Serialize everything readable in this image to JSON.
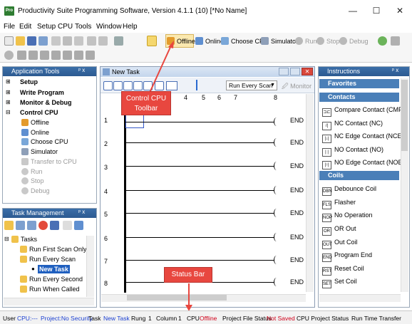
{
  "window": {
    "icon_label": "Pro",
    "title": "Productivity Suite Programming Software, Version 4.1.1 (10)  [*No Name]",
    "minimize": "—",
    "maximize": "☐",
    "close": "✕"
  },
  "menu": [
    "File",
    "Edit",
    "Setup",
    "CPU",
    "Tools",
    "Window",
    "Help"
  ],
  "toolbar": {
    "offline": "Offline",
    "online": "Online",
    "choose_cpu": "Choose CPU",
    "simulator": "Simulator",
    "run": "Run",
    "stop": "Stop",
    "debug": "Debug"
  },
  "app_tools": {
    "title": "Application Tools",
    "pin": "ᵖ x",
    "items": [
      {
        "label": "Setup",
        "style": "bold"
      },
      {
        "label": "Write Program",
        "style": "bold"
      },
      {
        "label": "Monitor & Debug",
        "style": "bold"
      },
      {
        "label": "Control CPU",
        "style": "bold"
      },
      {
        "label": "Offline",
        "style": "normal"
      },
      {
        "label": "Online",
        "style": "normal"
      },
      {
        "label": "Choose CPU",
        "style": "normal"
      },
      {
        "label": "Simulator",
        "style": "normal"
      },
      {
        "label": "Transfer to CPU",
        "style": "grey"
      },
      {
        "label": "Run",
        "style": "grey"
      },
      {
        "label": "Stop",
        "style": "grey"
      },
      {
        "label": "Debug",
        "style": "grey"
      }
    ]
  },
  "task_mgmt": {
    "title": "Task Management",
    "pin": "ᵖ x",
    "items": [
      {
        "label": "Tasks"
      },
      {
        "label": "Run First Scan Only"
      },
      {
        "label": "Run Every Scan"
      },
      {
        "label": "New Task"
      },
      {
        "label": "Run Every Second"
      },
      {
        "label": "Run When Called"
      }
    ]
  },
  "editor": {
    "title": "New Task",
    "scan_mode": "Run Every Scan",
    "monitor": "Monitor",
    "columns": [
      "4",
      "5",
      "6",
      "7",
      "8"
    ],
    "rungs": [
      "1",
      "2",
      "3",
      "4",
      "5",
      "6",
      "7",
      "8"
    ],
    "end_label": "END"
  },
  "instructions": {
    "title": "Instructions",
    "pin": "ᵖ x",
    "favorites": "Favorites",
    "contacts": "Contacts",
    "coils": "Coils",
    "contact_items": [
      {
        "glyph": "⊐⊏",
        "label": "Compare Contact (CMP)"
      },
      {
        "glyph": "/|",
        "label": "NC Contact (NC)"
      },
      {
        "glyph": "|↓|",
        "label": "NC Edge Contact (NCE)"
      },
      {
        "glyph": "| |",
        "label": "NO Contact (NO)"
      },
      {
        "glyph": "|↑|",
        "label": "NO Edge Contact (NOE)"
      }
    ],
    "coil_items": [
      {
        "glyph": "DBN",
        "label": "Debounce Coil"
      },
      {
        "glyph": "FLS",
        "label": "Flasher"
      },
      {
        "glyph": "NOP",
        "label": "No Operation"
      },
      {
        "glyph": "OR",
        "label": "OR Out"
      },
      {
        "glyph": "OUT",
        "label": "Out Coil"
      },
      {
        "glyph": "END",
        "label": "Program End"
      },
      {
        "glyph": "RST",
        "label": "Reset Coil"
      },
      {
        "glyph": "SET",
        "label": "Set Coil"
      }
    ]
  },
  "callouts": {
    "control_cpu": "Control CPU\nToolbar",
    "status_bar": "Status Bar"
  },
  "status": {
    "user": "User",
    "cpu_label": "CPU:---",
    "project": "Project:No Security",
    "task_label": "Task",
    "task_value": "New Task",
    "rung_label": "Rung",
    "rung_value": "1",
    "column_label": "Column",
    "column_value": "1",
    "cpu2_label": "CPU",
    "cpu2_value": "Offline",
    "pfs_label": "Project File Status",
    "pfs_value": "Not Saved",
    "cps_label": "CPU Project Status",
    "rtt_label": "Run Time Transfer"
  },
  "colors": {
    "accent": "#3b6ea8",
    "callout": "#e8473f",
    "status_red": "#d0021b",
    "status_blue": "#1a3fd1"
  }
}
